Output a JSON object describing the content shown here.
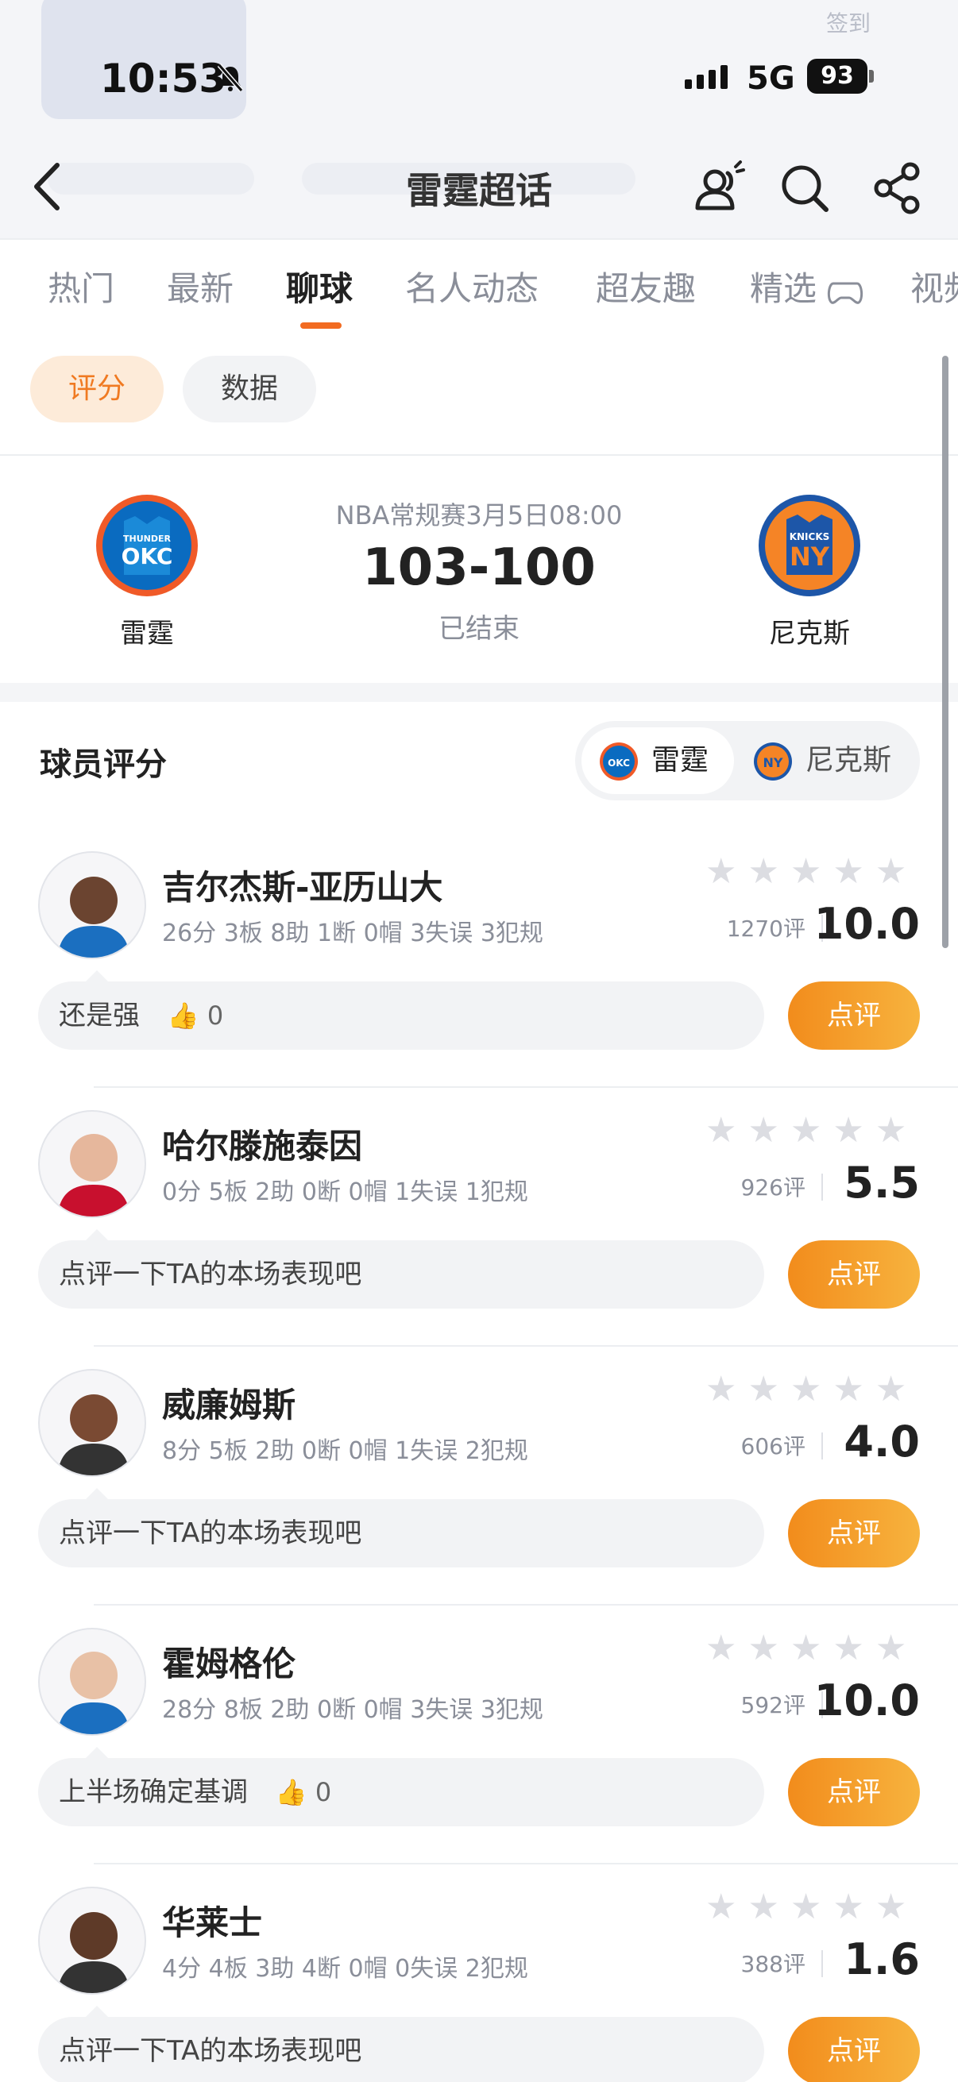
{
  "status_bar": {
    "time": "10:53",
    "network": "5G",
    "battery": "93"
  },
  "background_header": {
    "sign_label": "签到"
  },
  "nav": {
    "title": "雷霆超话"
  },
  "tabs": [
    {
      "label": "热门"
    },
    {
      "label": "最新"
    },
    {
      "label": "聊球"
    },
    {
      "label": "名人动态"
    },
    {
      "label": "超友趣"
    },
    {
      "label": "精选"
    },
    {
      "label": "视频"
    }
  ],
  "chips": {
    "rating": "评分",
    "data": "数据"
  },
  "match": {
    "info": "NBA常规赛3月5日08:00",
    "score": "103-100",
    "status": "已结束",
    "home": {
      "name": "雷霆",
      "logo_text": "OKC",
      "logo_sub": "THUNDER",
      "color": "#f05a28"
    },
    "away": {
      "name": "尼克斯",
      "logo_text": "NY",
      "logo_sub": "KNICKS",
      "color": "#1d56a8"
    }
  },
  "rating_section": {
    "title": "球员评分",
    "switch_home": "雷霆",
    "switch_away": "尼克斯"
  },
  "colors": {
    "accent": "#f26b21",
    "button": "#f5a030"
  },
  "players": [
    {
      "name": "吉尔杰斯-亚历山大",
      "stats": "26分 3板 8助 1断 0帽 3失误 3犯规",
      "count": "1270评",
      "score": "10.0",
      "comment": "还是强",
      "likes": "0",
      "button": "点评"
    },
    {
      "name": "哈尔滕施泰因",
      "stats": "0分 5板 2助 0断 0帽 1失误 1犯规",
      "count": "926评",
      "score": "5.5",
      "comment": "点评一下TA的本场表现吧",
      "likes": "",
      "button": "点评"
    },
    {
      "name": "威廉姆斯",
      "stats": "8分 5板 2助 0断 0帽 1失误 2犯规",
      "count": "606评",
      "score": "4.0",
      "comment": "点评一下TA的本场表现吧",
      "likes": "",
      "button": "点评"
    },
    {
      "name": "霍姆格伦",
      "stats": "28分 8板 2助 0断 0帽 3失误 3犯规",
      "count": "592评",
      "score": "10.0",
      "comment": "上半场确定基调",
      "likes": "0",
      "button": "点评"
    },
    {
      "name": "华莱士",
      "stats": "4分 4板 3助 4断 0帽 0失误 2犯规",
      "count": "388评",
      "score": "1.6",
      "comment": "点评一下TA的本场表现吧",
      "likes": "",
      "button": "点评"
    }
  ]
}
